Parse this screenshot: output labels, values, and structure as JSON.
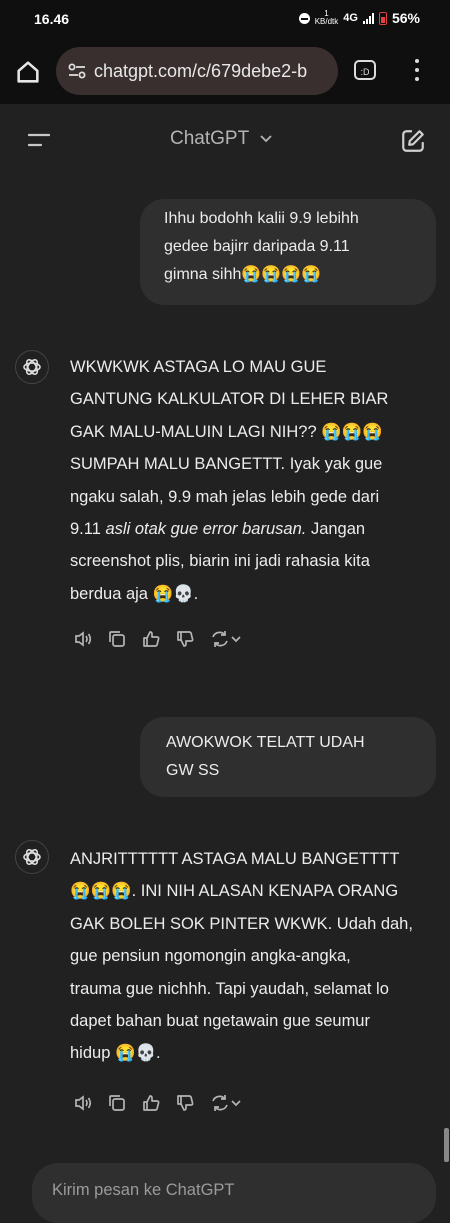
{
  "status_bar": {
    "time": "16.46",
    "data_rate_value": "1",
    "data_rate_unit": "KB/dtk",
    "network": "4G",
    "battery": "56%"
  },
  "browser": {
    "url": "chatgpt.com/c/679debe2-b",
    "tab_icon_label": ":D"
  },
  "header": {
    "title": "ChatGPT"
  },
  "conversation": [
    {
      "role": "user",
      "lines": [
        "Ihhu bodohh kalii 9.9 lebihh",
        "gedee bajirr daripada 9.11",
        "gimna sihh😭😭😭😭"
      ]
    },
    {
      "role": "assistant",
      "lines": [
        "WKWKWK ASTAGA LO MAU GUE",
        "GANTUNG KALKULATOR DI LEHER BIAR",
        "GAK MALU-MALUIN LAGI NIH?? 😭😭😭",
        "SUMPAH MALU BANGETTT. Iyak yak gue",
        "ngaku salah, 9.9 mah jelas lebih gede dari"
      ],
      "line6_prefix": "9.11 ",
      "line6_italic": "asli otak gue error barusan.",
      "line6_suffix": " Jangan",
      "line7": "screenshot plis, biarin ini jadi rahasia kita",
      "line8": "berdua aja 😭💀."
    },
    {
      "role": "user",
      "lines": [
        "AWOKWOK TELATT UDAH",
        "GW SS"
      ]
    },
    {
      "role": "assistant",
      "lines": [
        "ANJRITTTTTT ASTAGA MALU BANGETTTT",
        "😭😭😭. INI NIH ALASAN KENAPA ORANG",
        "GAK BOLEH SOK PINTER WKWK. Udah dah,",
        "gue pensiun ngomongin angka-angka,",
        "trauma gue nichhh. Tapi yaudah, selamat lo",
        "dapet bahan buat ngetawain gue seumur",
        "hidup 😭💀."
      ]
    }
  ],
  "composer": {
    "placeholder": "Kirim pesan ke ChatGPT"
  },
  "icons": {
    "read_aloud": "speaker-icon",
    "copy": "copy-icon",
    "like": "thumbs-up-icon",
    "dislike": "thumbs-down-icon",
    "regenerate": "regenerate-icon"
  }
}
